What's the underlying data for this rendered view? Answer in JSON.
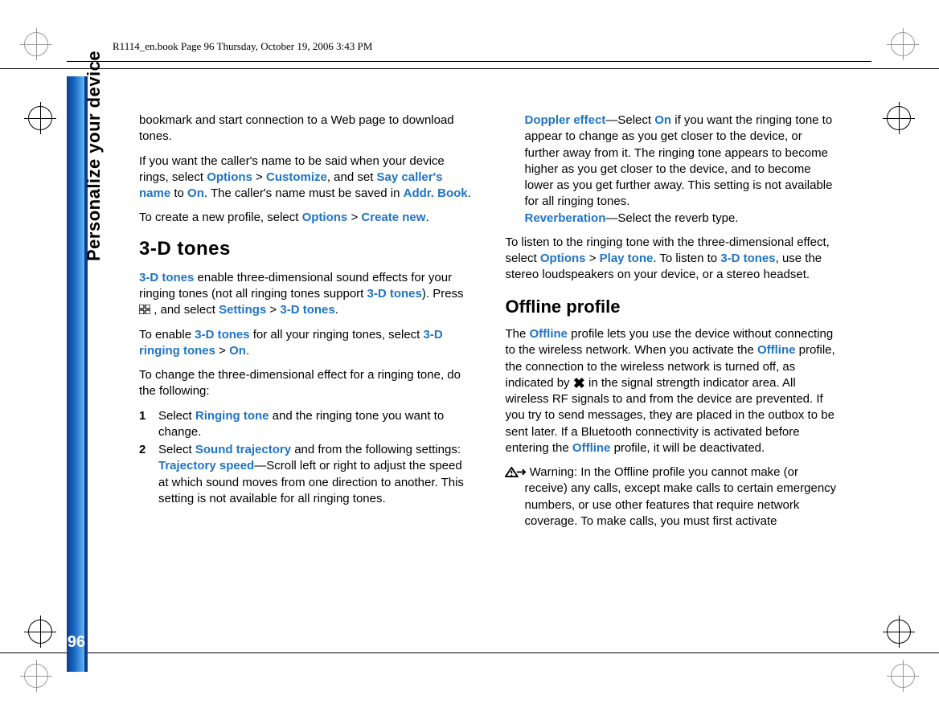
{
  "header": "R1114_en.book  Page 96  Thursday, October 19, 2006  3:43 PM",
  "side_title": "Personalize your device",
  "page_number": "96",
  "p1a": "bookmark and start connection to a Web page to download tones.",
  "p2_1": "If you want the caller's name to be said when your device rings, select ",
  "opt": "Options",
  "gt": " > ",
  "customize": "Customize",
  "p2_2": ", and set ",
  "say_caller": "Say caller's name",
  "p2_3": " to ",
  "on": "On",
  "p2_4": ". The caller's name must be saved in ",
  "addr_book": "Addr. Book",
  "dot": ".",
  "p3_1": "To create a new profile, select ",
  "create_new": "Create new",
  "h_3d": "3-D tones",
  "k_3dtones": "3-D tones",
  "p4_1": " enable three-dimensional sound effects for your ringing tones (not all ringing tones support ",
  "p4_2": "). Press ",
  "p4_3": " , and select ",
  "settings": "Settings",
  "p5_1": "To enable ",
  "p5_2": " for all your ringing tones, select ",
  "k_3dring": "3-D ringing tones",
  "p6": "To change the three-dimensional effect for a ringing tone, do the following:",
  "li1_1": "Select ",
  "ringing_tone": "Ringing tone",
  "li1_2": " and the ringing tone you want to change.",
  "li2_1": "Select ",
  "sound_traj": "Sound trajectory",
  "li2_2": " and from the following settings:",
  "traj_speed": "Trajectory speed",
  "traj_speed_t": "—Scroll left or right to adjust the speed at which sound moves from one direction to another. This setting is not available for all ringing tones.",
  "doppler": "Doppler effect",
  "doppler_1": "—Select ",
  "doppler_2": " if you want the ringing tone to appear to change as you get closer to the device, or further away from it. The ringing tone appears to become higher as you get closer to the device, and to become lower as you get further away. This setting is not available for all ringing tones.",
  "reverb": "Reverberation",
  "reverb_t": "—Select the reverb type.",
  "p7_1": "To listen to the ringing tone with the three-dimensional effect, select ",
  "play_tone": "Play tone",
  "p7_2": ". To listen to ",
  "p7_3": ", use the stereo loudspeakers on your device, or a stereo headset.",
  "h_offline": "Offline profile",
  "offline": "Offline",
  "p8_1": "The ",
  "p8_2": " profile lets you use the device without connecting to the wireless network. When you activate the ",
  "p8_3": " profile, the connection to the wireless network is turned off, as indicated by ",
  "p8_4": " in the signal strength indicator area. All wireless RF signals to and from the device are prevented. If you try to send messages, they are placed in the outbox to be sent later. If a Bluetooth connectivity is activated before entering the ",
  "p8_5": " profile, it will be deactivated.",
  "warn": " Warning: In the Offline profile you cannot make (or receive) any calls, except make calls to certain emergency numbers, or use other features that require network coverage. To make calls, you must first activate"
}
